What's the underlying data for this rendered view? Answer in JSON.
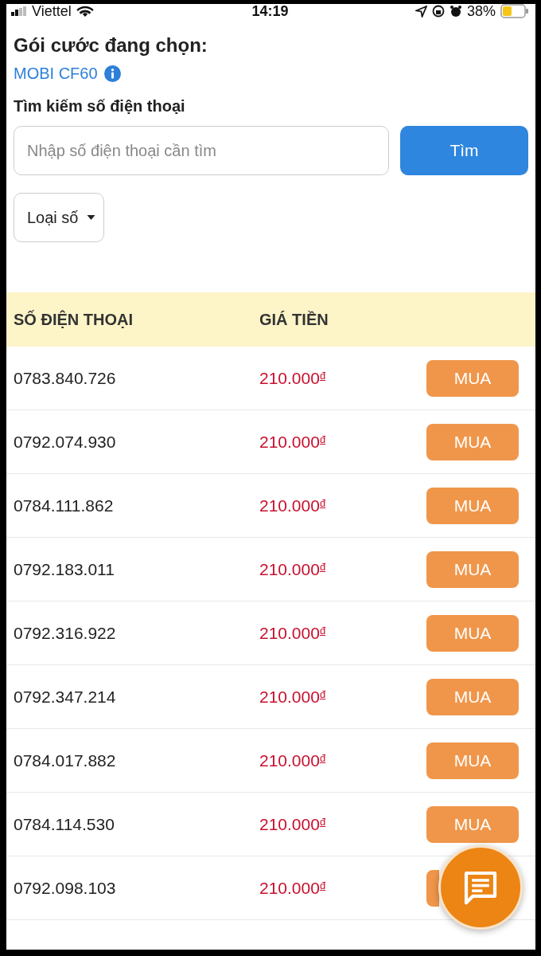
{
  "status_bar": {
    "carrier": "Viettel",
    "time": "14:19",
    "battery": "38%"
  },
  "plan": {
    "heading": "Gói cước đang chọn:",
    "name": "MOBI CF60"
  },
  "search": {
    "heading": "Tìm kiếm số điện thoại",
    "placeholder": "Nhập số điện thoại cần tìm",
    "button": "Tìm"
  },
  "filter": {
    "label": "Loại số"
  },
  "table": {
    "columns": [
      "SỐ ĐIỆN THOẠI",
      "GIÁ TIỀN"
    ],
    "rows": [
      {
        "number": "0783.840.726",
        "price": "210.000$^{đ}$",
        "action": "MUA"
      },
      {
        "number": "0792.074.930",
        "price": "210.000$^{đ}$",
        "action": "MUA"
      },
      {
        "number": "0784.111.862",
        "price": "210.000$^{đ}$",
        "action": "MUA"
      },
      {
        "number": "0792.183.011",
        "price": "210.000$^{đ}$",
        "action": "MUA"
      },
      {
        "number": "0792.316.922",
        "price": "210.000$^{đ}$",
        "action": "MUA"
      },
      {
        "number": "0792.347.214",
        "price": "210.000$^{đ}$",
        "action": "MUA"
      },
      {
        "number": "0784.017.882",
        "price": "210.000$^{đ}$",
        "action": "MUA"
      },
      {
        "number": "0784.114.530",
        "price": "210.000$^{đ}$",
        "action": "MUA"
      },
      {
        "number": "0792.098.103",
        "price": "210.000$^{đ}$"
      }
    ]
  }
}
